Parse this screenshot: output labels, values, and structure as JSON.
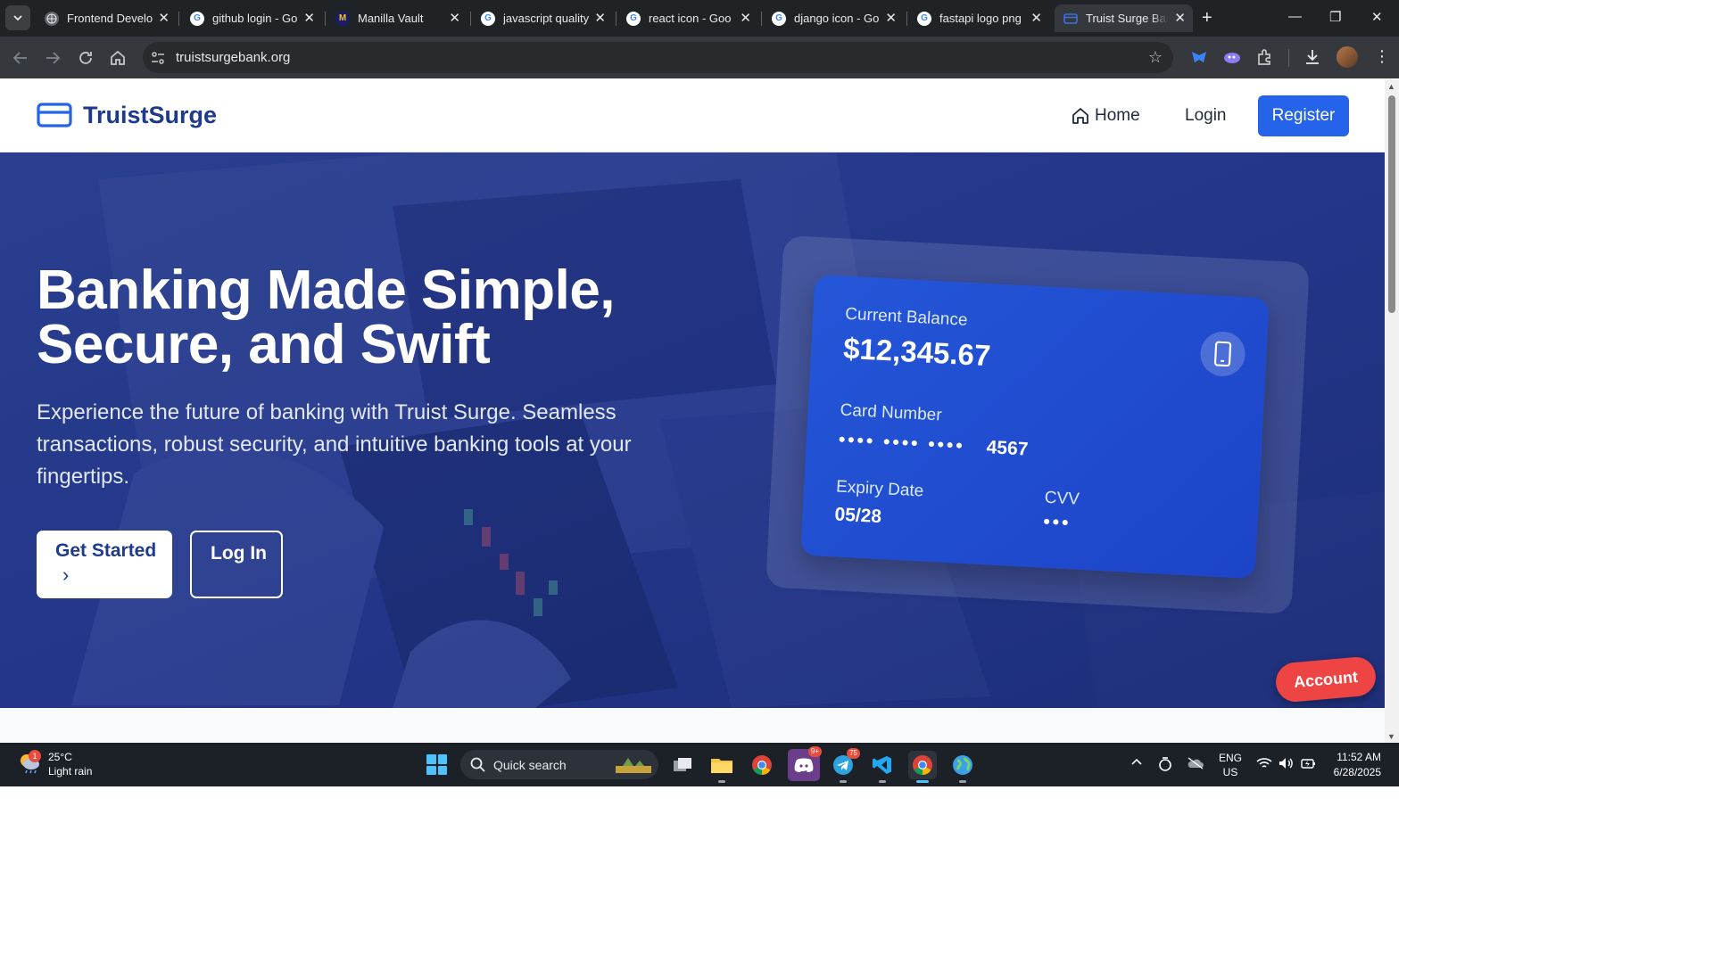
{
  "browser": {
    "tabs": [
      {
        "title": "Frontend Develo",
        "favicon": "globe-icon"
      },
      {
        "title": "github login - Go",
        "favicon": "google-icon"
      },
      {
        "title": "Manilla Vault",
        "favicon": "manilla-vault-icon"
      },
      {
        "title": "javascript quality",
        "favicon": "google-icon"
      },
      {
        "title": "react icon - Goo",
        "favicon": "google-icon"
      },
      {
        "title": "django icon - Go",
        "favicon": "google-icon"
      },
      {
        "title": "fastapi logo png",
        "favicon": "google-icon"
      },
      {
        "title": "Truist Surge Bank",
        "favicon": "card-icon",
        "active": true
      }
    ],
    "url": "truistsurgebank.org"
  },
  "site": {
    "brand": "TruistSurge",
    "nav": {
      "home": "Home",
      "login": "Login",
      "register": "Register"
    },
    "hero": {
      "title_line1": "Banking Made Simple,",
      "title_line2": "Secure, and Swift",
      "subtitle": "Experience the future of banking with Truist Surge. Seamless transactions, robust security, and intuitive banking tools at your fingertips.",
      "cta_primary": "Get Started",
      "cta_secondary": "Log In"
    },
    "card": {
      "balance_label": "Current Balance",
      "balance": "$12,345.67",
      "number_label": "Card Number",
      "number_masked": "•••• •••• ••••",
      "number_last4": "4567",
      "expiry_label": "Expiry Date",
      "expiry": "05/28",
      "cvv_label": "CVV",
      "cvv": "•••"
    },
    "floating_button": "Account"
  },
  "taskbar": {
    "weather_temp": "25°C",
    "weather_desc": "Light rain",
    "weather_badge": "1",
    "search_placeholder": "Quick search",
    "discord_badge": "9+",
    "telegram_badge": "75",
    "lang": "ENG",
    "region": "US",
    "time": "11:52 AM",
    "date": "6/28/2025"
  },
  "colors": {
    "brand": "#1e3a8a",
    "accent": "#2563eb",
    "danger": "#ef4444"
  }
}
